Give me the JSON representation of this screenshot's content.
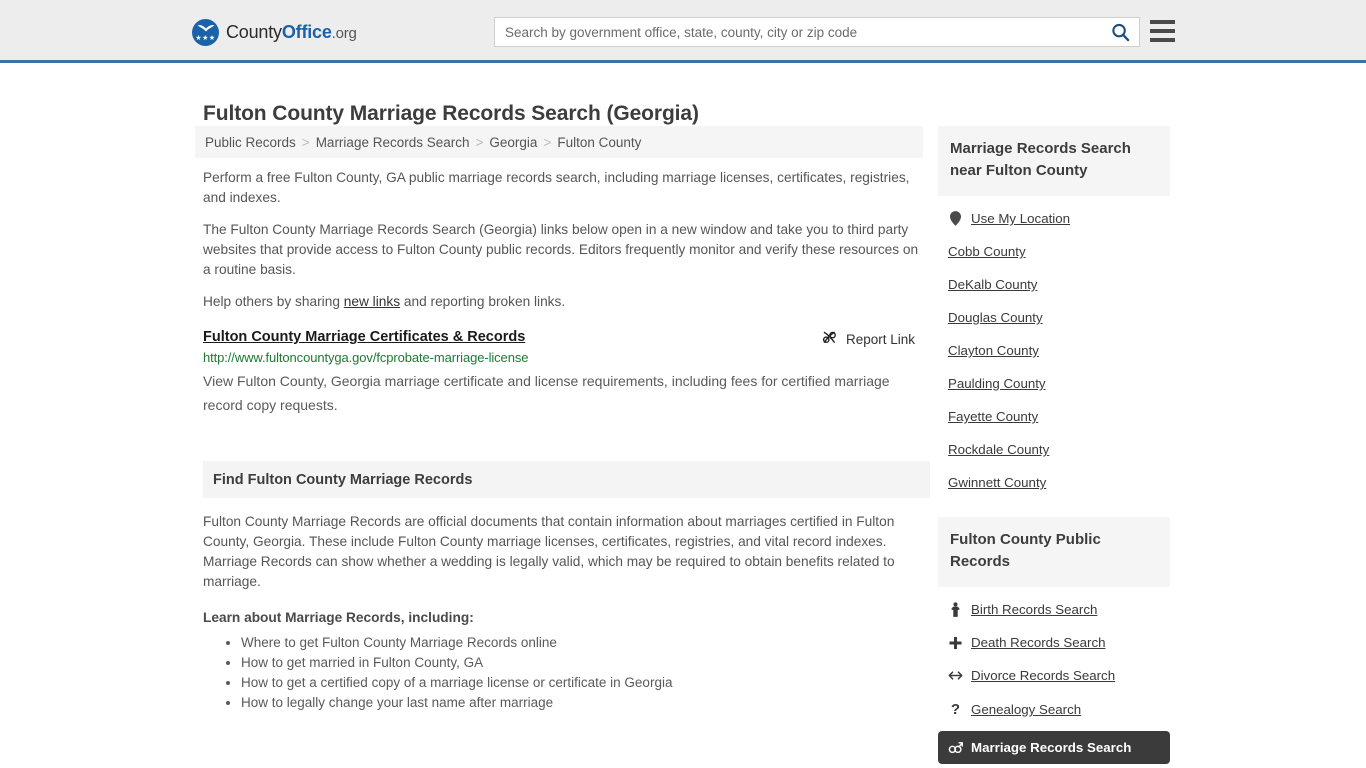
{
  "header": {
    "logo_text_1": "County",
    "logo_text_2": "Office",
    "logo_text_3": ".org",
    "logo_icon": "eagle-seal-icon",
    "search_placeholder": "Search by government office, state, county, city or zip code",
    "search_value": "",
    "search_icon": "search-icon",
    "menu_icon": "hamburger-menu-icon",
    "accent_color": "#3b74a4"
  },
  "page": {
    "title": "Fulton County Marriage Records Search (Georgia)"
  },
  "breadcrumb": {
    "separator": ">",
    "items": [
      {
        "label": "Public Records"
      },
      {
        "label": "Marriage Records Search"
      },
      {
        "label": "Georgia"
      },
      {
        "label": "Fulton County"
      }
    ]
  },
  "main": {
    "paragraphs": [
      "Perform a free Fulton County, GA public marriage records search, including marriage licenses, certificates, registries, and indexes.",
      "The Fulton County Marriage Records Search (Georgia) links below open in a new window and take you to third party websites that provide access to Fulton County public records. Editors frequently monitor and verify these resources on a routine basis."
    ],
    "share_prefix": "Help others by sharing ",
    "share_link": "new links",
    "share_suffix": " and reporting broken links.",
    "result": {
      "title": "Fulton County Marriage Certificates & Records",
      "url": "http://www.fultoncountyga.gov/fcprobate-marriage-license",
      "description": "View Fulton County, Georgia marriage certificate and license requirements, including fees for certified marriage record copy requests.",
      "report_label": "Report Link",
      "report_icon": "broken-link-icon",
      "url_color": "#1d7a33"
    },
    "section": {
      "heading": "Find Fulton County Marriage Records",
      "body": "Fulton County Marriage Records are official documents that contain information about marriages certified in Fulton County, Georgia. These include Fulton County marriage licenses, certificates, registries, and vital record indexes. Marriage Records can show whether a wedding is legally valid, which may be required to obtain benefits related to marriage.",
      "learn_heading": "Learn about Marriage Records, including:",
      "learn_items": [
        "Where to get Fulton County Marriage Records online",
        "How to get married in Fulton County, GA",
        "How to get a certified copy of a marriage license or certificate in Georgia",
        "How to legally change your last name after marriage"
      ]
    }
  },
  "sidebar": {
    "nearby": {
      "heading": "Marriage Records Search near Fulton County",
      "items": [
        {
          "label": "Use My Location",
          "icon": "map-pin-icon",
          "has_icon": true
        },
        {
          "label": "Cobb County",
          "icon": "",
          "has_icon": false
        },
        {
          "label": "DeKalb County",
          "icon": "",
          "has_icon": false
        },
        {
          "label": "Douglas County",
          "icon": "",
          "has_icon": false
        },
        {
          "label": "Clayton County",
          "icon": "",
          "has_icon": false
        },
        {
          "label": "Paulding County",
          "icon": "",
          "has_icon": false
        },
        {
          "label": "Fayette County",
          "icon": "",
          "has_icon": false
        },
        {
          "label": "Rockdale County",
          "icon": "",
          "has_icon": false
        },
        {
          "label": "Gwinnett County",
          "icon": "",
          "has_icon": false
        }
      ]
    },
    "public_records": {
      "heading": "Fulton County Public Records",
      "items": [
        {
          "label": "Birth Records Search",
          "icon": "baby-icon",
          "active": false
        },
        {
          "label": "Death Records Search",
          "icon": "cross-icon",
          "active": false
        },
        {
          "label": "Divorce Records Search",
          "icon": "double-arrow-icon",
          "active": false
        },
        {
          "label": "Genealogy Search",
          "icon": "question-mark-icon",
          "active": false
        },
        {
          "label": "Marriage Records Search",
          "icon": "male-female-icon",
          "active": true
        }
      ],
      "active_bg": "#3b3b3b"
    }
  }
}
